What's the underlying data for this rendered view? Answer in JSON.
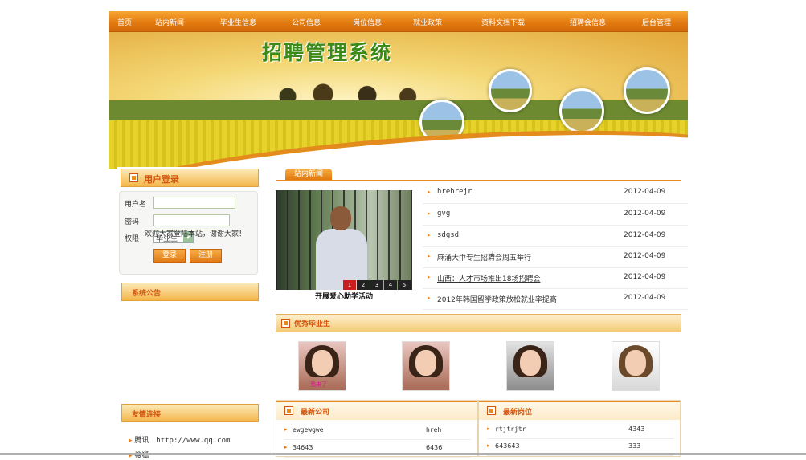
{
  "nav": {
    "items": [
      "首页",
      "站内新闻",
      "毕业生信息",
      "公司信息",
      "岗位信息",
      "就业政策",
      "资料文档下载",
      "招聘会信息",
      "后台管理"
    ]
  },
  "banner": {
    "title": "招聘管理系统"
  },
  "login": {
    "title": "用户登录",
    "username_label": "用户名",
    "password_label": "密码",
    "role_label": "权限",
    "role_value": "毕业生",
    "login_button": "登录",
    "register_button": "注册"
  },
  "notice": {
    "title": "系统公告",
    "text": "欢迎大家登陆本站，谢谢大家！"
  },
  "links": {
    "title": "友情连接",
    "items": [
      {
        "name": "腾讯",
        "url": "http://www.qq.com"
      },
      {
        "name": "搜狐",
        "url": ""
      }
    ]
  },
  "news": {
    "tab": "站内新闻",
    "photo_caption": "开展爱心助学活动",
    "thumbs": [
      "1",
      "2",
      "3",
      "4",
      "5"
    ],
    "rows": [
      {
        "title": "hrehrejr",
        "date": "2012-04-09"
      },
      {
        "title": "gvg",
        "date": "2012-04-09"
      },
      {
        "title": "sdgsd",
        "date": "2012-04-09"
      },
      {
        "title": "麻涌大中专生招聘会周五举行",
        "date": "2012-04-09"
      },
      {
        "title": "山西：人才市场推出18场招聘会",
        "date": "2012-04-09"
      },
      {
        "title": "2012年韩国留学政策放松就业率提高",
        "date": "2012-04-09"
      }
    ]
  },
  "excellent": {
    "title": "优秀毕业生",
    "caption": "我来了"
  },
  "companies": {
    "title": "最新公司",
    "rows": [
      {
        "name": "ewgewgwe",
        "value": "hreh"
      },
      {
        "name": "34643",
        "value": "6436"
      }
    ]
  },
  "positions": {
    "title": "最新岗位",
    "rows": [
      {
        "name": "rtjtrjtr",
        "value": "4343"
      },
      {
        "name": "643643",
        "value": "333"
      }
    ]
  }
}
